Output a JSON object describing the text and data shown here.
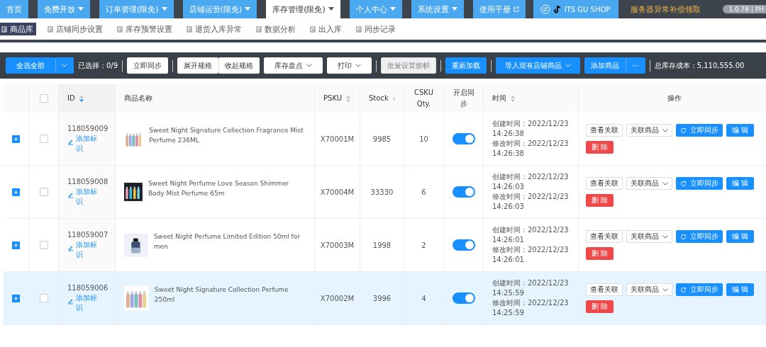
{
  "nav": {
    "tabs": [
      {
        "label": "首页",
        "dropdown": false,
        "selected": false
      },
      {
        "label": "免费开放",
        "dropdown": true,
        "selected": false
      },
      {
        "label": "订单管理(限免)",
        "dropdown": true,
        "selected": false
      },
      {
        "label": "店铺运营(限免)",
        "dropdown": true,
        "selected": false
      },
      {
        "label": "库存管理(限免)",
        "dropdown": true,
        "selected": true
      },
      {
        "label": "个人中心",
        "dropdown": true,
        "selected": false
      },
      {
        "label": "系统设置",
        "dropdown": true,
        "selected": false
      },
      {
        "label": "使用手册",
        "dropdown": false,
        "selected": false,
        "external": true
      }
    ],
    "shop": "ITS GU SHOP",
    "promo": "服务器异常补偿领取",
    "version": "1.0.78 | PH"
  },
  "subnav": [
    {
      "label": "商品库",
      "selected": true
    },
    {
      "label": "店铺同步设置",
      "selected": false
    },
    {
      "label": "库存预警设置",
      "selected": false
    },
    {
      "label": "退货入库异常",
      "selected": false
    },
    {
      "label": "数据分析",
      "selected": false
    },
    {
      "label": "出入库",
      "selected": false
    },
    {
      "label": "同步记录",
      "selected": false
    }
  ],
  "toolbar": [
    {
      "kind": "split",
      "label": "全选全部"
    },
    {
      "kind": "text",
      "label": "已选择：0/9"
    },
    {
      "kind": "sep"
    },
    {
      "kind": "default",
      "label": "立即同步"
    },
    {
      "kind": "sep"
    },
    {
      "kind": "group",
      "labels": [
        "展开规格",
        "收起规格"
      ]
    },
    {
      "kind": "dropdown",
      "label": "库存盘点"
    },
    {
      "kind": "dropdown",
      "label": "打印"
    },
    {
      "kind": "sep"
    },
    {
      "kind": "disabled",
      "label": "批量设置旗帜"
    },
    {
      "kind": "sep"
    },
    {
      "kind": "primary",
      "label": "重新加载"
    },
    {
      "kind": "sep"
    },
    {
      "kind": "primary-dropdown",
      "label": "导入现有店铺商品"
    },
    {
      "kind": "more",
      "label": "添加商品",
      "more": "···"
    },
    {
      "kind": "sep"
    },
    {
      "kind": "text",
      "label": "总库存成本：5,110,555.00"
    }
  ],
  "table": {
    "columns": [
      {
        "sortable": false
      },
      {
        "sortable": false,
        "kind": "checkbox"
      },
      {
        "label": "ID",
        "sortable": true,
        "sort_desc": true
      },
      {
        "label": "商品名称",
        "sortable": false
      },
      {
        "label": "PSKU",
        "sortable": true,
        "sort_desc": false
      },
      {
        "label": "Stock",
        "sortable": true,
        "sort_desc": false
      },
      {
        "label": "CSKU Qty.",
        "sortable": false
      },
      {
        "label": "开启同步",
        "sortable": false
      },
      {
        "label": "时间",
        "sortable": true,
        "sort_desc": false
      },
      {
        "label": "操作",
        "sortable": false
      }
    ],
    "header_checked": false,
    "rows": [
      {
        "id": "118059009",
        "tag_link": "添加标识",
        "name": "Sweet Night Signature Collection Fragrance Mist Perfume 236ML",
        "psku": "X70001M",
        "stock": "9985",
        "csku_qty": "10",
        "sync_on": true,
        "checked": false,
        "highlighted": false,
        "created": "创建时间：2022/12/23",
        "created_time": "14:26:38",
        "modified": "修改时间：2022/12/23",
        "modified_time": "14:26:38",
        "actions": {
          "view": "查看关联",
          "link": "关联商品",
          "sync": "立即同步",
          "edit": "编 辑",
          "delete": "删 除"
        }
      },
      {
        "id": "118059008",
        "tag_link": "添加标识",
        "name": "Sweet Night Perfume Love Season Shimmer Body Mist Perfume 65m",
        "psku": "X70004M",
        "stock": "33330",
        "csku_qty": "6",
        "sync_on": true,
        "checked": false,
        "highlighted": false,
        "created": "创建时间：2022/12/23",
        "created_time": "14:26:03",
        "modified": "修改时间：2022/12/23",
        "modified_time": "14:26:03",
        "actions": {
          "view": "查看关联",
          "link": "关联商品",
          "sync": "立即同步",
          "edit": "编 辑",
          "delete": "删 除"
        }
      },
      {
        "id": "118059007",
        "tag_link": "添加标识",
        "name": "Sweet Night Perfume Limited Edition 50ml for men",
        "psku": "X70003M",
        "stock": "1998",
        "csku_qty": "2",
        "sync_on": true,
        "checked": false,
        "highlighted": false,
        "created": "创建时间：2022/12/23",
        "created_time": "14:26:01",
        "modified": "修改时间：2022/12/23",
        "modified_time": "14:26:01",
        "actions": {
          "view": "查看关联",
          "link": "关联商品",
          "sync": "立即同步",
          "edit": "编 辑",
          "delete": "删 除"
        }
      },
      {
        "id": "118059006",
        "tag_link": "添加标识",
        "name": "Sweet Night Signature Collection Perfume 250ml",
        "psku": "X70002M",
        "stock": "3996",
        "csku_qty": "4",
        "sync_on": true,
        "checked": false,
        "highlighted": true,
        "created": "创建时间：2022/12/23",
        "created_time": "14:25:59",
        "modified": "修改时间：2022/12/23",
        "modified_time": "14:25:59",
        "actions": {
          "view": "查看关联",
          "link": "关联商品",
          "sync": "立即同步",
          "edit": "编 辑",
          "delete": "删 除"
        }
      }
    ]
  }
}
